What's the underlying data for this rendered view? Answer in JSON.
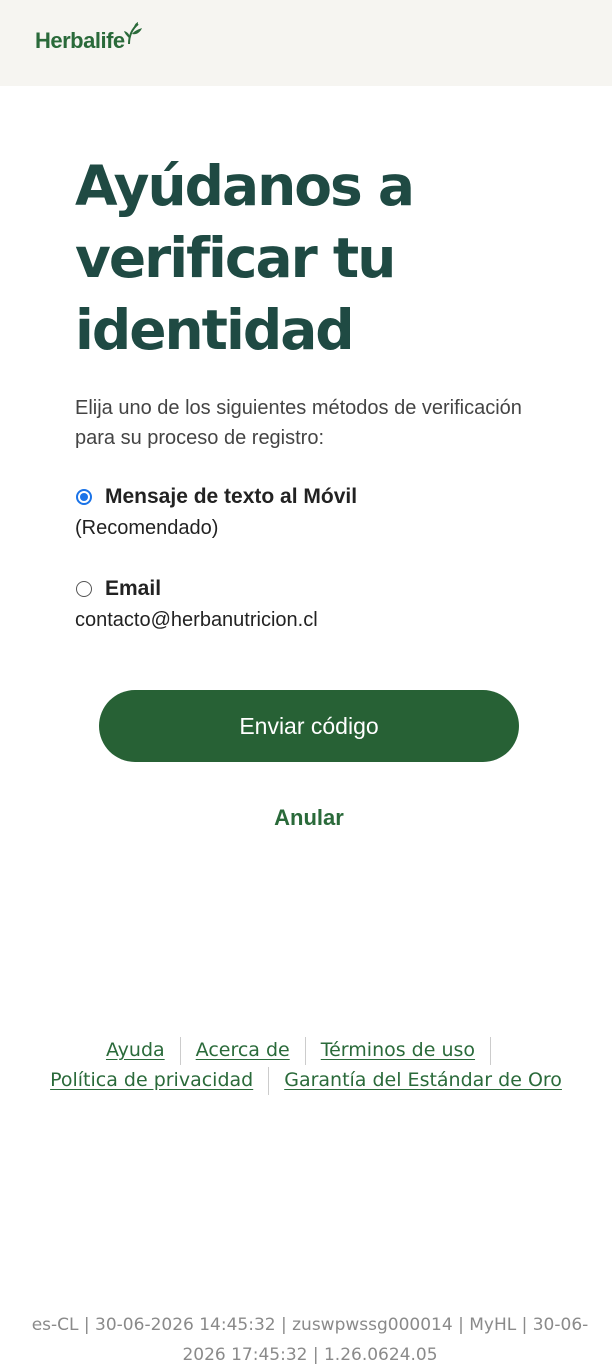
{
  "header": {
    "logo_text": "Herbalife",
    "logo_icon": "leaf-icon",
    "brand_color": "#2a6a3a",
    "background": "#f6f5f1"
  },
  "main": {
    "title": "Ayúdanos a verificar tu identidad",
    "intro": "Elija uno de los siguientes métodos de verificación para su proceso de registro:",
    "options": [
      {
        "label": "Mensaje de texto al Móvil",
        "sublabel": "(Recomendado)",
        "selected": true
      },
      {
        "label": "Email",
        "sublabel": "contacto@herbanutricion.cl",
        "selected": false
      }
    ],
    "send_button_label": "Enviar código",
    "cancel_label": "Anular",
    "title_color": "#1f4a43",
    "button_color": "#276135"
  },
  "footer": {
    "links": [
      "Ayuda",
      "Acerca de",
      "Términos de uso",
      "Política de privacidad",
      "Garantía del Estándar de Oro"
    ],
    "meta": "es-CL | 30-06-2026 14:45:32 | zuswpwssg000014 | MyHL | 30-06-2026 17:45:32 | 1.26.0624.05"
  }
}
